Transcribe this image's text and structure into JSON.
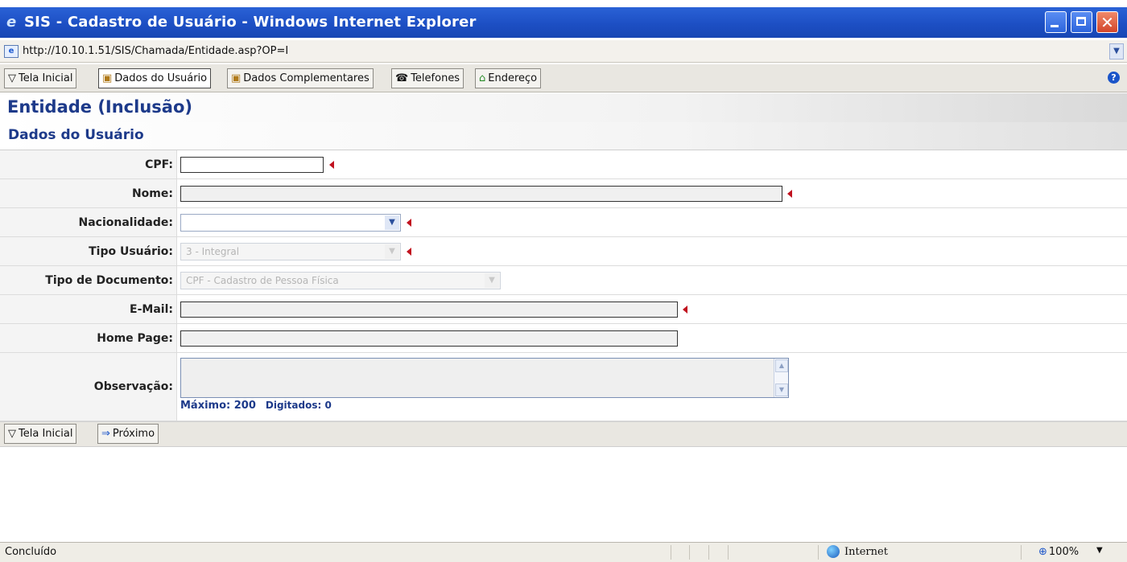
{
  "window": {
    "title": "SIS - Cadastro de Usuário - Windows Internet Explorer",
    "close_glyph": "✕"
  },
  "address": {
    "url": "http://10.10.1.51/SIS/Chamada/Entidade.asp?OP=I"
  },
  "toolbar": {
    "buttons": [
      {
        "label": "Tela Inicial",
        "icon": "filter-icon"
      },
      {
        "label": "Dados do Usuário",
        "icon": "user-card-icon"
      },
      {
        "label": "Dados Complementares",
        "icon": "user-card-icon"
      },
      {
        "label": "Telefones",
        "icon": "phone-icon"
      },
      {
        "label": "Endereço",
        "icon": "home-icon"
      }
    ]
  },
  "page": {
    "title": "Entidade (Inclusão)",
    "section": "Dados do Usuário"
  },
  "form": {
    "cpf_label": "CPF:",
    "nome_label": "Nome:",
    "nacionalidade_label": "Nacionalidade:",
    "tipo_usuario_label": "Tipo Usuário:",
    "tipo_usuario_value": "3 - Integral",
    "tipo_documento_label": "Tipo de Documento:",
    "tipo_documento_value": "CPF - Cadastro de Pessoa Física",
    "email_label": "E-Mail:",
    "homepage_label": "Home Page:",
    "observacao_label": "Observação:",
    "maximo": "Máximo: 200",
    "digitados": "Digitados: 0"
  },
  "bottom": {
    "tela_inicial": "Tela Inicial",
    "proximo": "Próximo"
  },
  "status": {
    "text": "Concluído",
    "zone": "Internet",
    "zoom": "100%"
  },
  "colors": {
    "title_bar": "#1d4fc4",
    "heading": "#1d3a8a",
    "required_marker": "#c1121f"
  }
}
